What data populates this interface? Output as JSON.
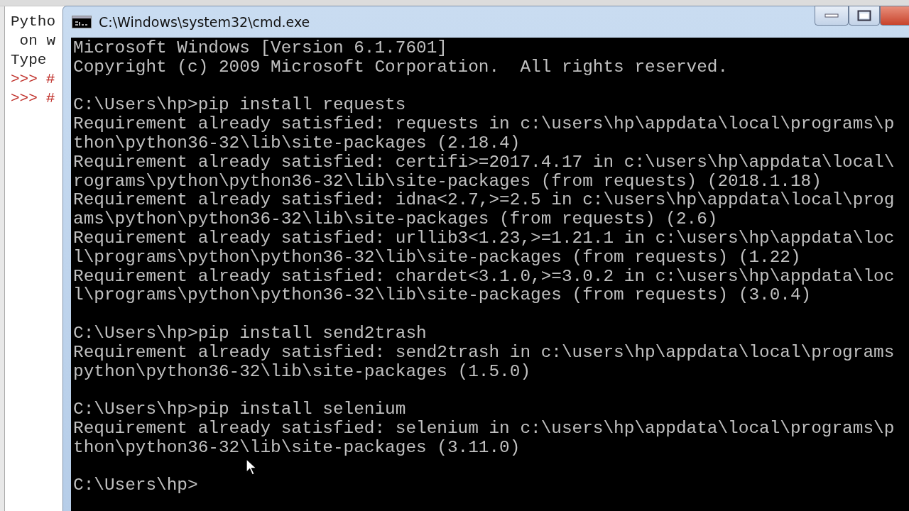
{
  "idle_window": {
    "lines": [
      {
        "kind": "text",
        "text": "Pytho"
      },
      {
        "kind": "text",
        "text": " on w"
      },
      {
        "kind": "text",
        "text": "Type"
      },
      {
        "kind": "prompt",
        "prompt": ">>>",
        "text": "#"
      },
      {
        "kind": "prompt",
        "prompt": ">>>",
        "text": "#"
      }
    ]
  },
  "console_window": {
    "title": "C:\\Windows\\system32\\cmd.exe",
    "blocks": [
      {
        "lines": [
          "Microsoft Windows [Version 6.1.7601]",
          "Copyright (c) 2009 Microsoft Corporation.  All rights reserved."
        ]
      },
      {
        "lines": [
          "C:\\Users\\hp>pip install requests",
          "Requirement already satisfied: requests in c:\\users\\hp\\appdata\\local\\programs\\p",
          "thon\\python36-32\\lib\\site-packages (2.18.4)",
          "Requirement already satisfied: certifi>=2017.4.17 in c:\\users\\hp\\appdata\\local\\",
          "rograms\\python\\python36-32\\lib\\site-packages (from requests) (2018.1.18)",
          "Requirement already satisfied: idna<2.7,>=2.5 in c:\\users\\hp\\appdata\\local\\prog",
          "ams\\python\\python36-32\\lib\\site-packages (from requests) (2.6)",
          "Requirement already satisfied: urllib3<1.23,>=1.21.1 in c:\\users\\hp\\appdata\\loc",
          "l\\programs\\python\\python36-32\\lib\\site-packages (from requests) (1.22)",
          "Requirement already satisfied: chardet<3.1.0,>=3.0.2 in c:\\users\\hp\\appdata\\loc",
          "l\\programs\\python\\python36-32\\lib\\site-packages (from requests) (3.0.4)"
        ]
      },
      {
        "lines": [
          "C:\\Users\\hp>pip install send2trash",
          "Requirement already satisfied: send2trash in c:\\users\\hp\\appdata\\local\\programs",
          "python\\python36-32\\lib\\site-packages (1.5.0)"
        ]
      },
      {
        "lines": [
          "C:\\Users\\hp>pip install selenium",
          "Requirement already satisfied: selenium in c:\\users\\hp\\appdata\\local\\programs\\p",
          "thon\\python36-32\\lib\\site-packages (3.11.0)"
        ]
      },
      {
        "lines": [
          "C:\\Users\\hp>"
        ]
      }
    ]
  }
}
